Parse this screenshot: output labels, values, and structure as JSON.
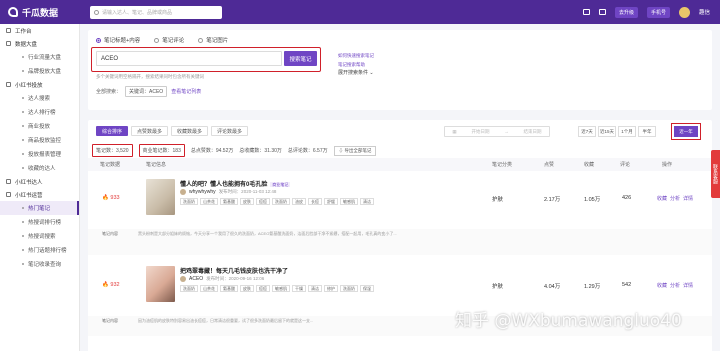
{
  "header": {
    "logo": "千瓜数据",
    "search_placeholder": "请输入达人、笔记、品牌或商品",
    "upgrade": "去升级",
    "mobile": "手机号",
    "username": "趣信"
  },
  "sidebar": {
    "items": [
      {
        "type": "head",
        "label": "工作台"
      },
      {
        "type": "head",
        "label": "数据大盘"
      },
      {
        "type": "item",
        "label": "行业流量大盘"
      },
      {
        "type": "item",
        "label": "品牌投放大盘"
      },
      {
        "type": "head",
        "label": "小红书投放"
      },
      {
        "type": "item",
        "label": "达人搜索"
      },
      {
        "type": "item",
        "label": "达人排行榜"
      },
      {
        "type": "item",
        "label": "商业投放"
      },
      {
        "type": "item",
        "label": "商品投放监控"
      },
      {
        "type": "item",
        "label": "投放报表管理"
      },
      {
        "type": "item",
        "label": "收藏的达人"
      },
      {
        "type": "head",
        "label": "小红书达人"
      },
      {
        "type": "head",
        "label": "小红书运营"
      },
      {
        "type": "item",
        "label": "热门笔记",
        "active": true
      },
      {
        "type": "item",
        "label": "热搜词排行榜"
      },
      {
        "type": "item",
        "label": "热搜词搜索"
      },
      {
        "type": "item",
        "label": "热门话题排行榜"
      },
      {
        "type": "item",
        "label": "笔记收录查询"
      }
    ]
  },
  "search_panel": {
    "options": [
      "笔记标题+内容",
      "笔记评论",
      "笔记图片"
    ],
    "keyword": "ACEO",
    "search_btn": "搜索笔记",
    "hint": "多个关键词用空格隔开，搜索结果同时包含所有关键词",
    "link1": "如何快速搜索笔记",
    "link2": "笔记搜索帮助",
    "expand": "展开搜索条件",
    "whole_label": "全部搜索：",
    "whole_chip": "关键词：ACEO",
    "whole_link": "查看笔记列表"
  },
  "result_panel": {
    "sort": [
      "综合排序",
      "点赞数最多",
      "收藏数最多",
      "评论数最多"
    ],
    "date_start": "开始日期",
    "date_end": "结束日期",
    "ranges": [
      "近7天",
      "近15天",
      "1个月",
      "半年"
    ],
    "year": "近一年",
    "stats": {
      "notes": "笔记数：3,520",
      "business": "商业笔记数：183",
      "likes": "总点赞数：94.52万",
      "collects": "总收藏数：31.30万",
      "comments": "总评论数：6.57万"
    },
    "export": "导出全部笔记",
    "columns": [
      "笔记数据",
      "笔记信息",
      "笔记分类",
      "点赞",
      "收藏",
      "评论",
      "操作"
    ],
    "rows": [
      {
        "rank": "933",
        "title": "懂人的吧？懂人也能拥有0毛孔脸",
        "flag": "商业笔记",
        "author": "whywhywhy",
        "time": "发布时间：2020-11-03 12:48",
        "tags": [
          "洗面奶",
          "山茶花",
          "氨基酸",
          "皮肤",
          "痘痘",
          "洗面奶",
          "油皮",
          "长痘",
          "舒缓",
          "敏感肌",
          "清洁"
        ],
        "category": "护肤",
        "likes": "2.17万",
        "collects": "1.05万",
        "comments": "426",
        "desc_label": "笔记内容",
        "desc": "黑头粉刺是大部分姐妹的烦恼，今天分享一个我用了很久的洗面奶，ACEO氨基酸洗面奶，洁面后脸部干净不紧绷，搭配一起用，毛孔真的变小了..."
      },
      {
        "rank": "932",
        "title": "把鸡翠毒藏！每天几毛钱皮肤也洗干净了",
        "flag": "",
        "author": "ACEO",
        "time": "发布时间：2020-09-16 12:06",
        "tags": [
          "洗面奶",
          "山茶花",
          "氨基酸",
          "皮肤",
          "痘痘",
          "敏感肌",
          "干燥",
          "清洁",
          "修护",
          "洗面奶",
          "保湿"
        ],
        "category": "护肤",
        "likes": "4.04万",
        "collects": "1.29万",
        "comments": "542",
        "desc_label": "笔记内容",
        "desc": "因为油痘肌的皮肤特别容易出油长痘痘，日常清洁很重要，试了很多洗面奶最后留下的就是这一支..."
      }
    ],
    "ops": [
      "收藏",
      "分析",
      "详情"
    ]
  },
  "floating": "联系客服",
  "watermark": "知乎 @WXbumawangluo40"
}
